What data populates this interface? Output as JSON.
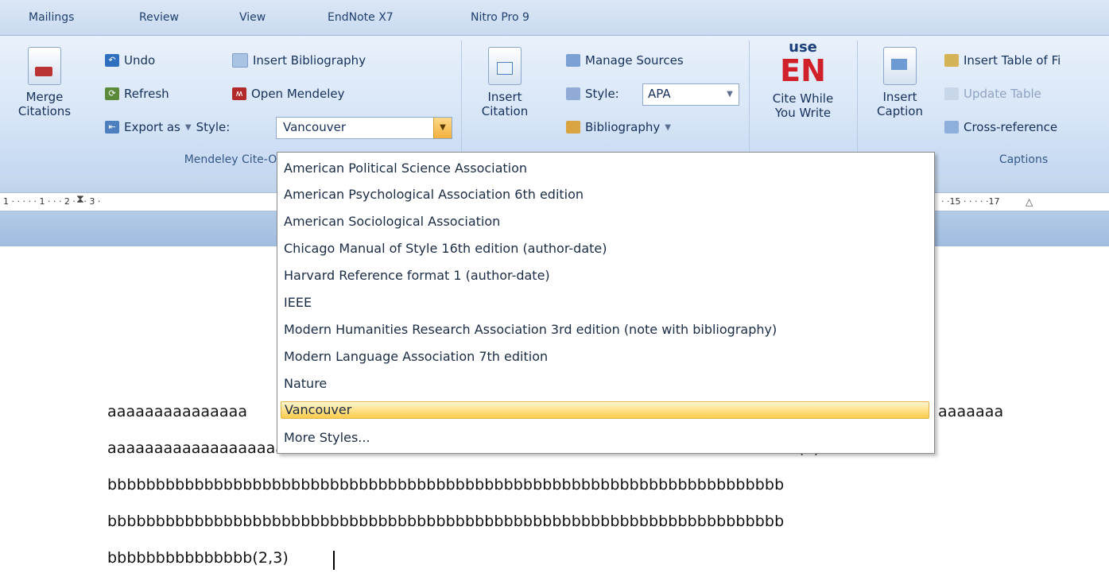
{
  "tabs": [
    "Mailings",
    "Review",
    "View",
    "EndNote X7",
    "Nitro Pro 9"
  ],
  "mendeley": {
    "merge_top": "Merge",
    "merge_bottom": "Citations",
    "undo": "Undo",
    "refresh": "Refresh",
    "export": "Export as",
    "insert_bibliography": "Insert Bibliography",
    "open_mendeley": "Open Mendeley",
    "style_label": "Style:",
    "style_value": "Vancouver",
    "group_label": "Mendeley Cite-O"
  },
  "citations": {
    "insert_top": "Insert",
    "insert_bottom": "Citation",
    "manage_sources": "Manage Sources",
    "style_label": "Style:",
    "style_value": "APA",
    "bibliography": "Bibliography"
  },
  "endnote": {
    "logo_top": "use",
    "logo_main": "EN",
    "label_top": "Cite While",
    "label_bottom": "You Write"
  },
  "captions": {
    "insert_top": "Insert",
    "insert_bottom": "Caption",
    "insert_table": "Insert Table of Fi",
    "update_table": "Update Table",
    "cross_reference": "Cross-reference",
    "group_label": "Captions"
  },
  "ruler": {
    "left_numbers": "1 · · ·  · · 1 · · · 2 · · · 3 ·",
    "right_numbers": "· ·15 · · ·    · ·17"
  },
  "style_menu": {
    "items": [
      "American Political Science Association",
      "American Psychological Association 6th edition",
      "American Sociological Association",
      "Chicago Manual of Style 16th edition (author-date)",
      "Harvard Reference format 1 (author-date)",
      "IEEE",
      "Modern Humanities Research Association 3rd edition (note with bibliography)",
      "Modern Language Association 7th edition",
      "Nature",
      "Vancouver",
      "More Styles..."
    ],
    "selected": "Vancouver"
  },
  "document": {
    "line1_left": "aaaaaaaaaaaaaaa",
    "line1_right": "aaaaaaa",
    "line2": "aaaaaaaaaaaaaaaaaaaaaaaaaaaaaaaaaaaaaaaaaaaaaaaaaaaaaaaaaaaaaaaaaaaaaaaaaa(1)bbbbb",
    "line3": "bbbbbbbbbbbbbbbbbbbbbbbbbbbbbbbbbbbbbbbbbbbbbbbbbbbbbbbbbbbbbbbbbbbbbb",
    "line4": "bbbbbbbbbbbbbbbbbbbbbbbbbbbbbbbbbbbbbbbbbbbbbbbbbbbbbbbbbbbbbbbbbbbbbb",
    "line5": "bbbbbbbbbbbbbbb(2,3)"
  }
}
